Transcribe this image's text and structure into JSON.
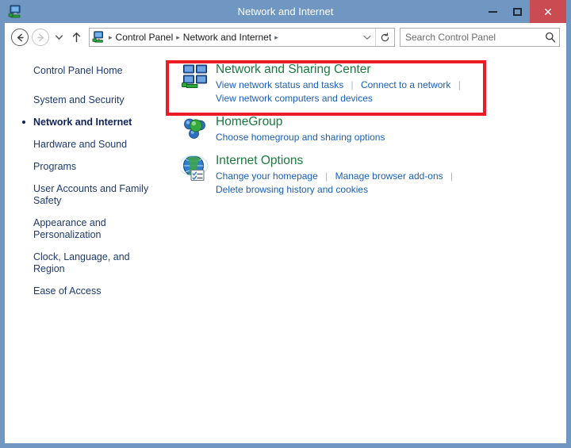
{
  "window": {
    "title": "Network and Internet",
    "titlebar_color": "#6f97c2",
    "close_color": "#cb4b52",
    "app_icon": "network-computer-icon",
    "controls": {
      "minimize_label": "Minimize",
      "maximize_label": "Maximize",
      "close_label": "Close",
      "close_glyph": "✕"
    }
  },
  "navbar": {
    "back_label": "Back",
    "forward_label": "Forward",
    "recent_label": "Recent locations",
    "up_label": "Up one level",
    "address_icon": "network-computer-icon",
    "breadcrumbs": [
      {
        "label": "Control Panel"
      },
      {
        "label": "Network and Internet"
      }
    ],
    "breadcrumb_separator": "▸",
    "dropdown_glyph": "˅",
    "refresh_glyph": "↻",
    "search": {
      "placeholder": "Search Control Panel",
      "value": "",
      "icon": "search-icon"
    }
  },
  "sidebar": {
    "items": [
      {
        "label": "Control Panel Home",
        "current": false
      },
      {
        "label": "System and Security",
        "current": false
      },
      {
        "label": "Network and Internet",
        "current": true
      },
      {
        "label": "Hardware and Sound",
        "current": false
      },
      {
        "label": "Programs",
        "current": false
      },
      {
        "label": "User Accounts and Family Safety",
        "current": false
      },
      {
        "label": "Appearance and Personalization",
        "current": false
      },
      {
        "label": "Clock, Language, and Region",
        "current": false
      },
      {
        "label": "Ease of Access",
        "current": false
      }
    ]
  },
  "content": {
    "highlight_color": "#ec1c24",
    "heading_color": "#1a7a3e",
    "link_color": "#1a5fb4",
    "categories": [
      {
        "title": "Network and Sharing Center",
        "icon": "network-monitors-icon",
        "highlighted": true,
        "links_row1": [
          "View network status and tasks",
          "Connect to a network"
        ],
        "row1_trailing_separator": true,
        "links_row2": [
          "View network computers and devices"
        ]
      },
      {
        "title": "HomeGroup",
        "icon": "homegroup-spheres-icon",
        "highlighted": false,
        "links_row1": [
          "Choose homegroup and sharing options"
        ],
        "row1_trailing_separator": false,
        "links_row2": []
      },
      {
        "title": "Internet Options",
        "icon": "globe-checklist-icon",
        "highlighted": false,
        "links_row1": [
          "Change your homepage",
          "Manage browser add-ons"
        ],
        "row1_trailing_separator": true,
        "links_row2": [
          "Delete browsing history and cookies"
        ]
      }
    ]
  }
}
